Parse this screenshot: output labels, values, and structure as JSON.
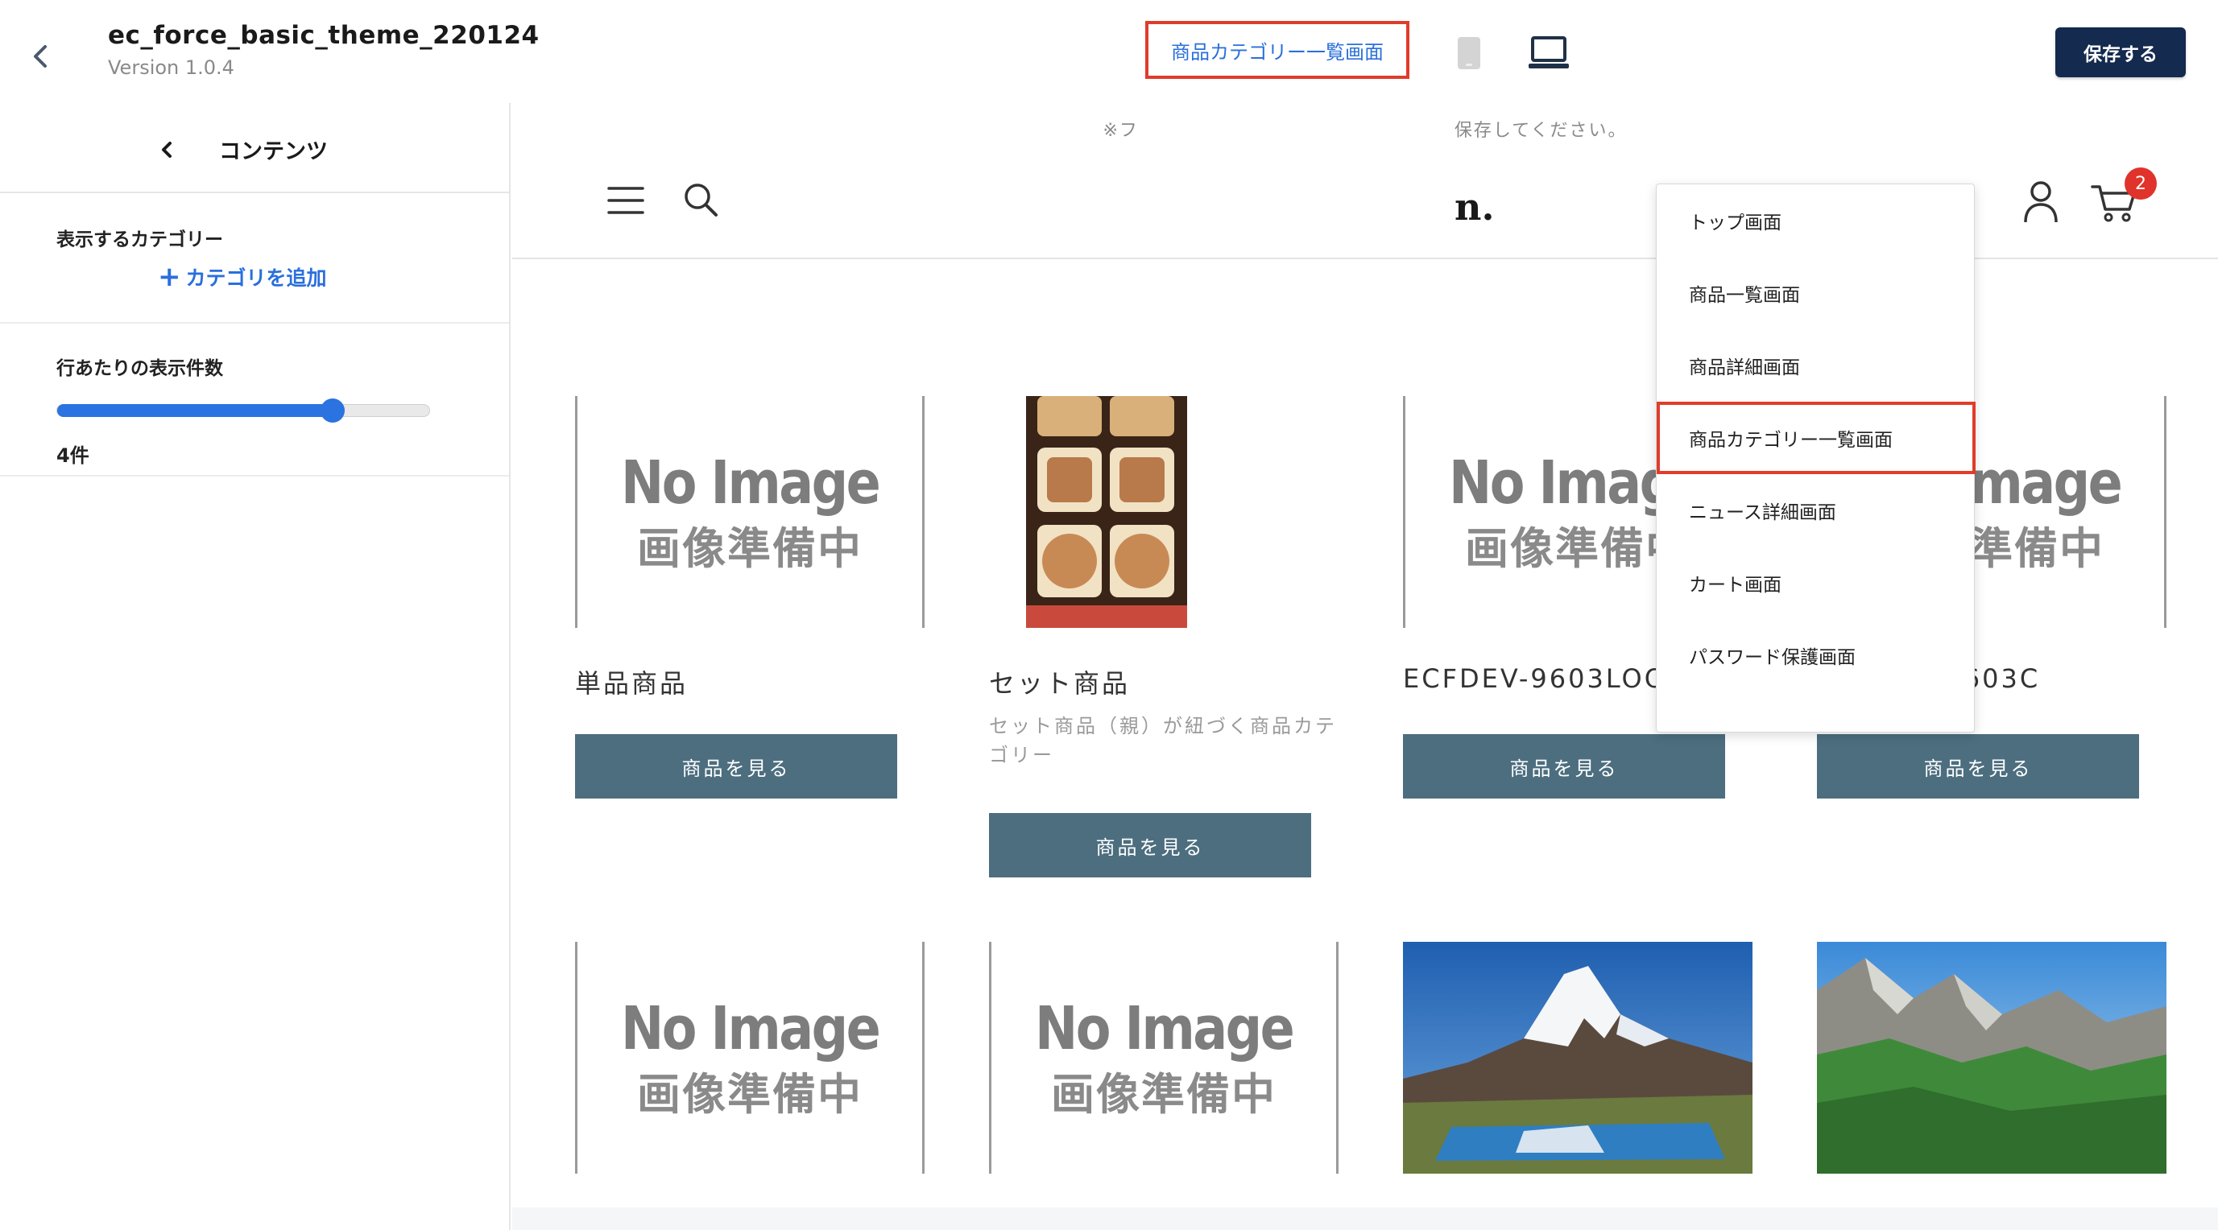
{
  "app": {
    "theme_name": "ec_force_basic_theme_220124",
    "version": "Version 1.0.4",
    "selected_page": "商品カテゴリー一覧画面",
    "save_label": "保存する"
  },
  "sidebar": {
    "title": "コンテンツ",
    "category_section_label": "表示するカテゴリー",
    "add_category_label": "カテゴリを追加",
    "per_row_label": "行あたりの表示件数",
    "per_row_value_text": "4件",
    "per_row_slider_fraction": 0.74
  },
  "dropdown": {
    "items": [
      {
        "label": "トップ画面"
      },
      {
        "label": "商品一覧画面"
      },
      {
        "label": "商品詳細画面"
      },
      {
        "label": "商品カテゴリー一覧画面",
        "selected": true
      },
      {
        "label": "ニュース詳細画面"
      },
      {
        "label": "カート画面"
      },
      {
        "label": "パスワード保護画面"
      }
    ]
  },
  "preview": {
    "notice_left": "※フ",
    "notice_right": "保存してください。",
    "logo_visible_part": "n.",
    "cart_count": "2",
    "noimage_text": "No Image",
    "noimage_sub": "画像準備中",
    "products": [
      {
        "name": "単品商品",
        "button": "商品を見る"
      },
      {
        "name": "セット商品",
        "description": "セット商品（親）が紐づく商品カテゴリー",
        "button": "商品を見る"
      },
      {
        "name": "ECFDEV-9603LOOONG",
        "button": "商品を見る"
      },
      {
        "name": "ECFDEV-9603C",
        "button": "商品を見る"
      }
    ]
  },
  "colors": {
    "accent_blue": "#2a73e0",
    "highlight_red": "#e03c2c",
    "save_button": "#142a4e",
    "product_button": "#4c6e7f",
    "badge_red": "#e0332b"
  }
}
